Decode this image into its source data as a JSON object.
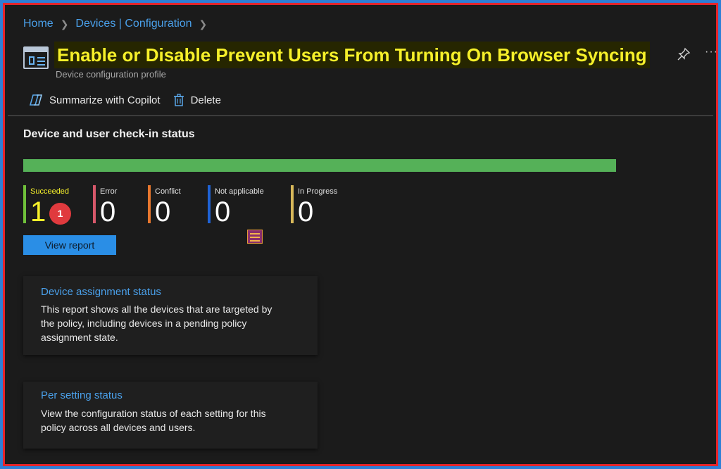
{
  "breadcrumb": {
    "items": [
      "Home",
      "Devices | Configuration"
    ]
  },
  "header": {
    "title": "Enable or Disable Prevent Users From Turning On Browser Syncing",
    "subtitle": "Device configuration profile",
    "icon": "config-profile-icon"
  },
  "toolbar": {
    "summarize_label": "Summarize with Copilot",
    "delete_label": "Delete"
  },
  "checkin": {
    "title": "Device and user check-in status",
    "progress_fraction": 1.0,
    "stats": [
      {
        "label": "Succeeded",
        "value": "1",
        "color": "#6fbf3a",
        "label_color": "#f6f02a"
      },
      {
        "label": "Error",
        "value": "0",
        "color": "#d6586a"
      },
      {
        "label": "Conflict",
        "value": "0",
        "color": "#e8772e"
      },
      {
        "label": "Not applicable",
        "value": "0",
        "color": "#1f63d6"
      },
      {
        "label": "In Progress",
        "value": "0",
        "color": "#d8b85a"
      }
    ],
    "badge_number": "1",
    "view_report_label": "View report"
  },
  "cards": [
    {
      "title": "Device assignment status",
      "description": "This report shows all the devices that are targeted by the policy, including devices in a pending policy assignment state."
    },
    {
      "title": "Per setting status",
      "description": "View the configuration status of each setting for this policy across all devices and users."
    }
  ]
}
